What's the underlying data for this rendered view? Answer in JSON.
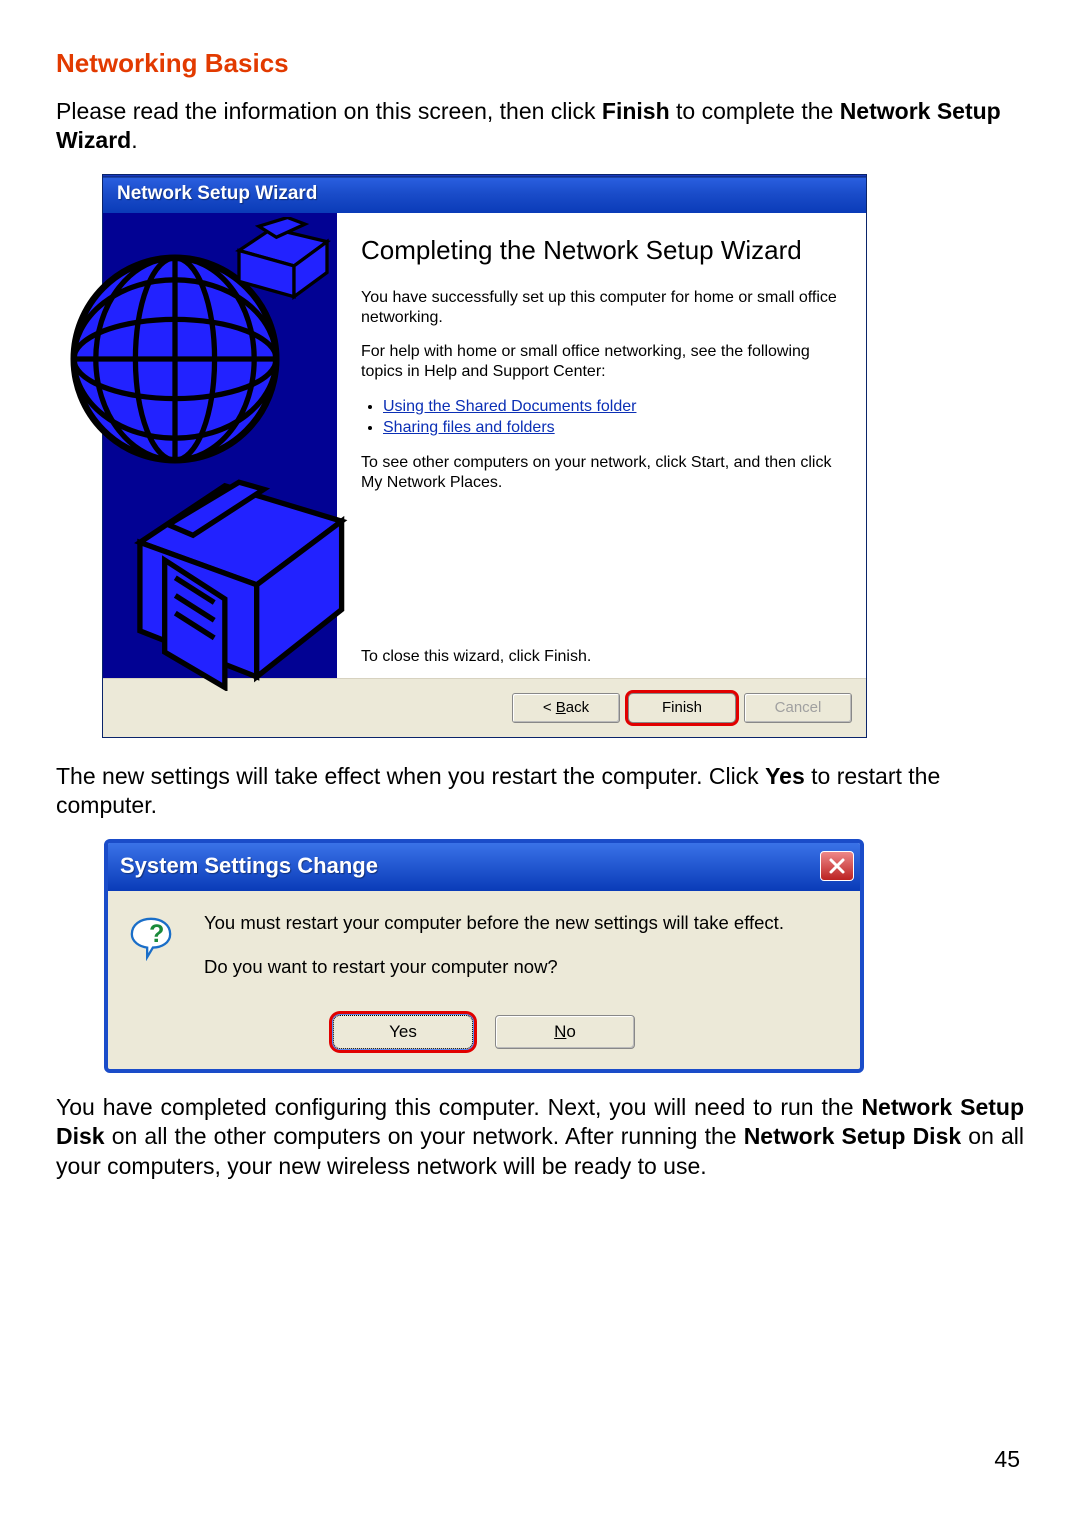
{
  "page_number": "45",
  "section_title": "Networking Basics",
  "intro_para": {
    "pre": "Please read the information on this screen, then click ",
    "bold1": "Finish",
    "mid": " to complete the ",
    "bold2": "Network Setup Wizard",
    "post": "."
  },
  "wizard": {
    "titlebar": "Network Setup Wizard",
    "heading": "Completing the Network Setup Wizard",
    "para1": "You have successfully set up this computer for home or small office networking.",
    "para2": "For help with home or small office networking, see the following topics in Help and Support Center:",
    "link1": "Using the Shared Documents folder",
    "link2": "Sharing files and folders",
    "para3": "To see other computers on your network, click Start, and then click My Network Places.",
    "close_hint": "To close this wizard, click Finish.",
    "buttons": {
      "back_pre": "< ",
      "back_u": "B",
      "back_post": "ack",
      "finish": "Finish",
      "cancel": "Cancel"
    }
  },
  "mid_para": {
    "pre": "The new settings will take effect when you restart the computer. Click ",
    "bold": "Yes",
    "post": " to restart the computer."
  },
  "dialog": {
    "titlebar": "System Settings Change",
    "line1": "You must restart your computer before the new settings will take effect.",
    "line2": "Do you want to restart your computer now?",
    "yes": "Yes",
    "no_u": "N",
    "no_post": "o"
  },
  "end_para": {
    "pre": "You have completed configuring this computer. Next, you will need to run the ",
    "bold1": "Network Setup Disk",
    "mid": " on all the other computers on your network. After running the ",
    "bold2": "Network Setup Disk",
    "post": " on all your computers, your new wireless network will be ready to use."
  }
}
